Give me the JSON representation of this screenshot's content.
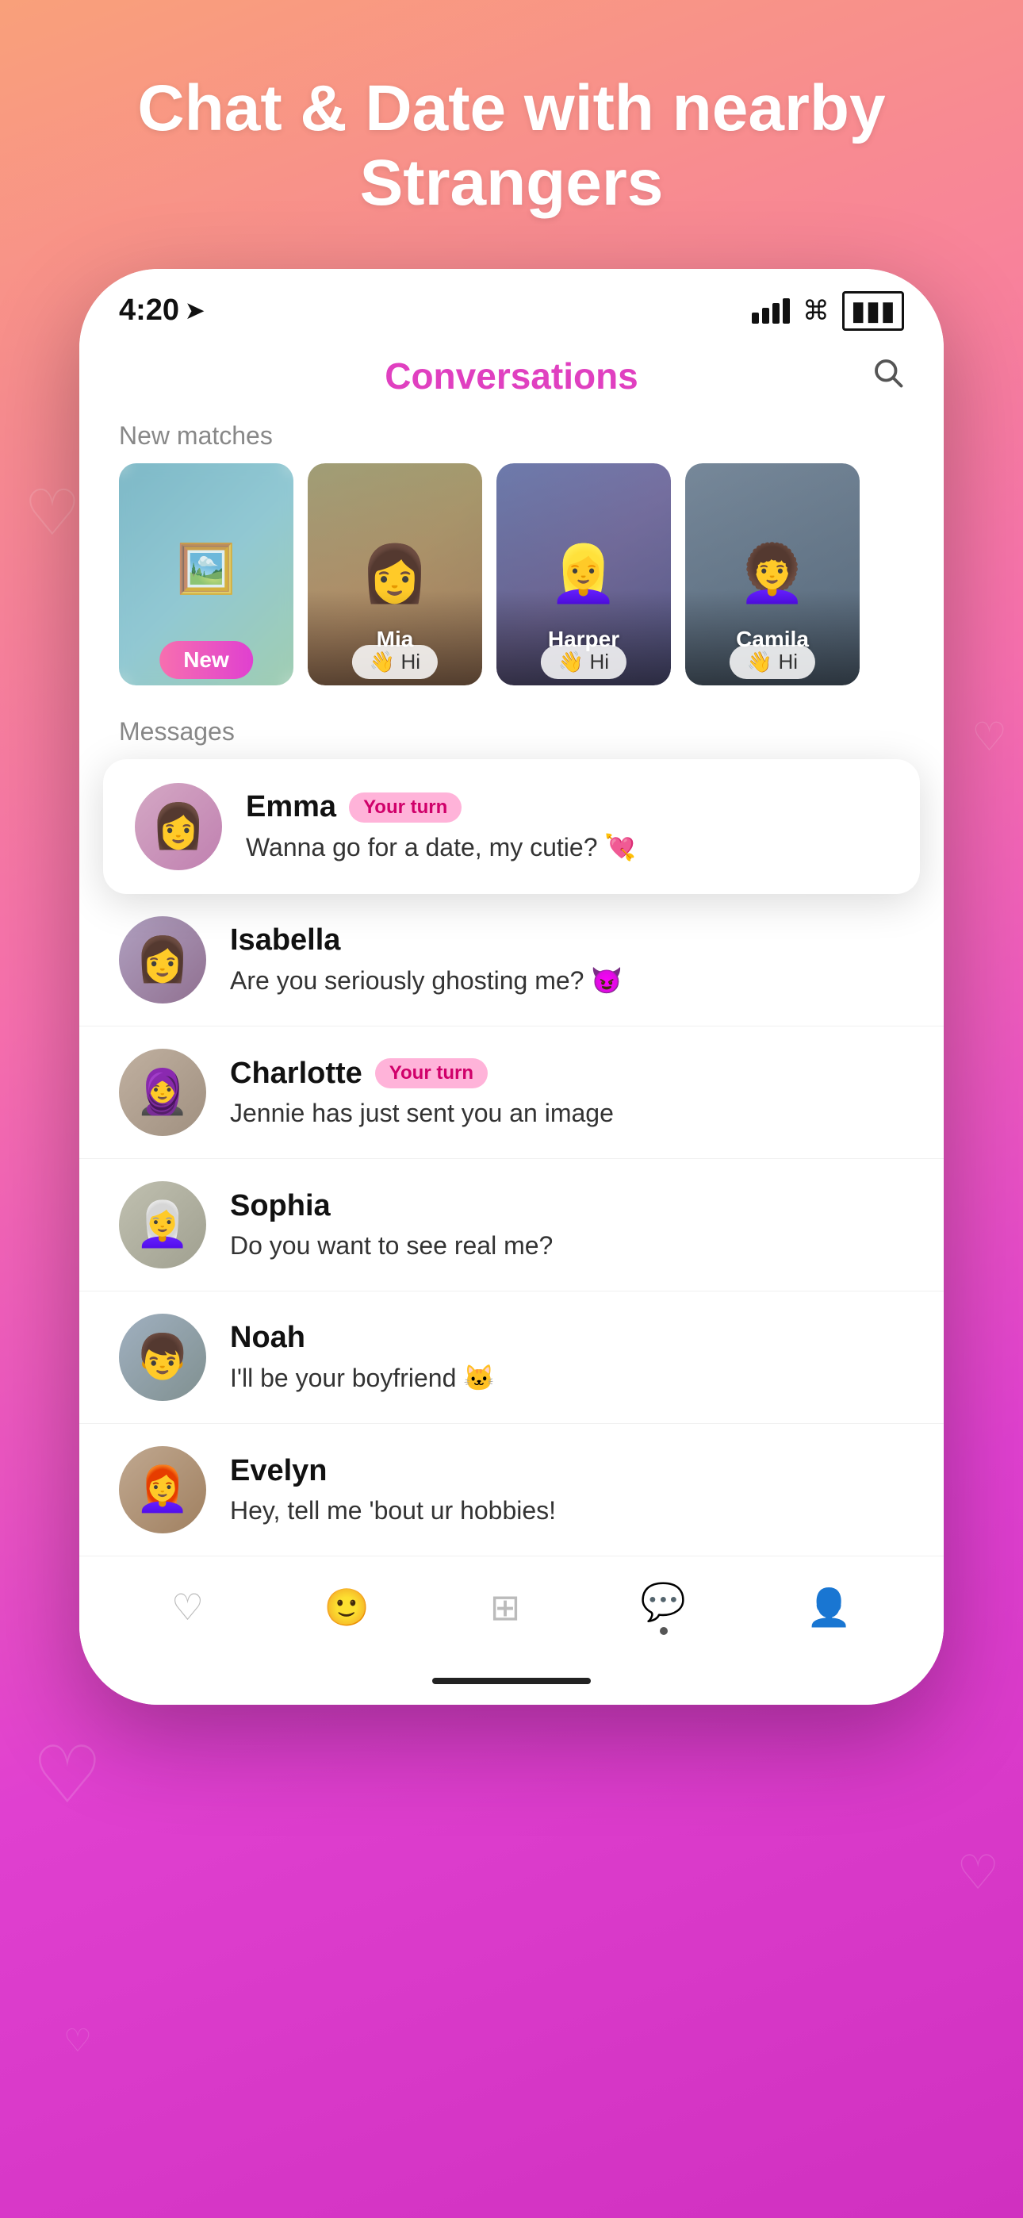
{
  "header": {
    "title": "Chat & Date with nearby\nStrangers"
  },
  "statusBar": {
    "time": "4:20",
    "location_icon": "▶",
    "battery": "■"
  },
  "app": {
    "screen_title": "Conversations",
    "search_label": "search",
    "new_matches_label": "New matches",
    "messages_label": "Messages"
  },
  "new_matches": [
    {
      "name": "",
      "hi_text": "",
      "is_new": true,
      "badge": "New"
    },
    {
      "name": "Mia",
      "hi_text": "👋 Hi",
      "is_new": false
    },
    {
      "name": "Harper",
      "hi_text": "👋 Hi",
      "is_new": false
    },
    {
      "name": "Camila",
      "hi_text": "👋 Hi",
      "is_new": false
    }
  ],
  "featured_message": {
    "name": "Emma",
    "badge": "Your turn",
    "preview": "Wanna go for a date, my cutie? 💘"
  },
  "messages": [
    {
      "name": "Isabella",
      "preview": "Are you seriously ghosting me? 😈",
      "badge": null
    },
    {
      "name": "Charlotte",
      "preview": "Jennie has just sent you an image",
      "badge": "Your turn"
    },
    {
      "name": "Sophia",
      "preview": "Do you want to see real me?",
      "badge": null
    },
    {
      "name": "Noah",
      "preview": "I'll be your boyfriend 🐱",
      "badge": null
    },
    {
      "name": "Evelyn",
      "preview": "Hey, tell me 'bout ur hobbies!",
      "badge": null
    }
  ],
  "bottom_nav": [
    {
      "icon": "♡",
      "label": "likes",
      "active": false
    },
    {
      "icon": "😊",
      "label": "faces",
      "active": false
    },
    {
      "icon": "⊞",
      "label": "grid",
      "active": false
    },
    {
      "icon": "💬",
      "label": "chat",
      "active": true
    },
    {
      "icon": "👤",
      "label": "profile",
      "active": false
    }
  ],
  "colors": {
    "brand_pink": "#e040c0",
    "gradient_start": "#f9a07a",
    "gradient_end": "#d030c0",
    "your_turn_bg": "#ffb3d9",
    "your_turn_text": "#d0006a"
  }
}
